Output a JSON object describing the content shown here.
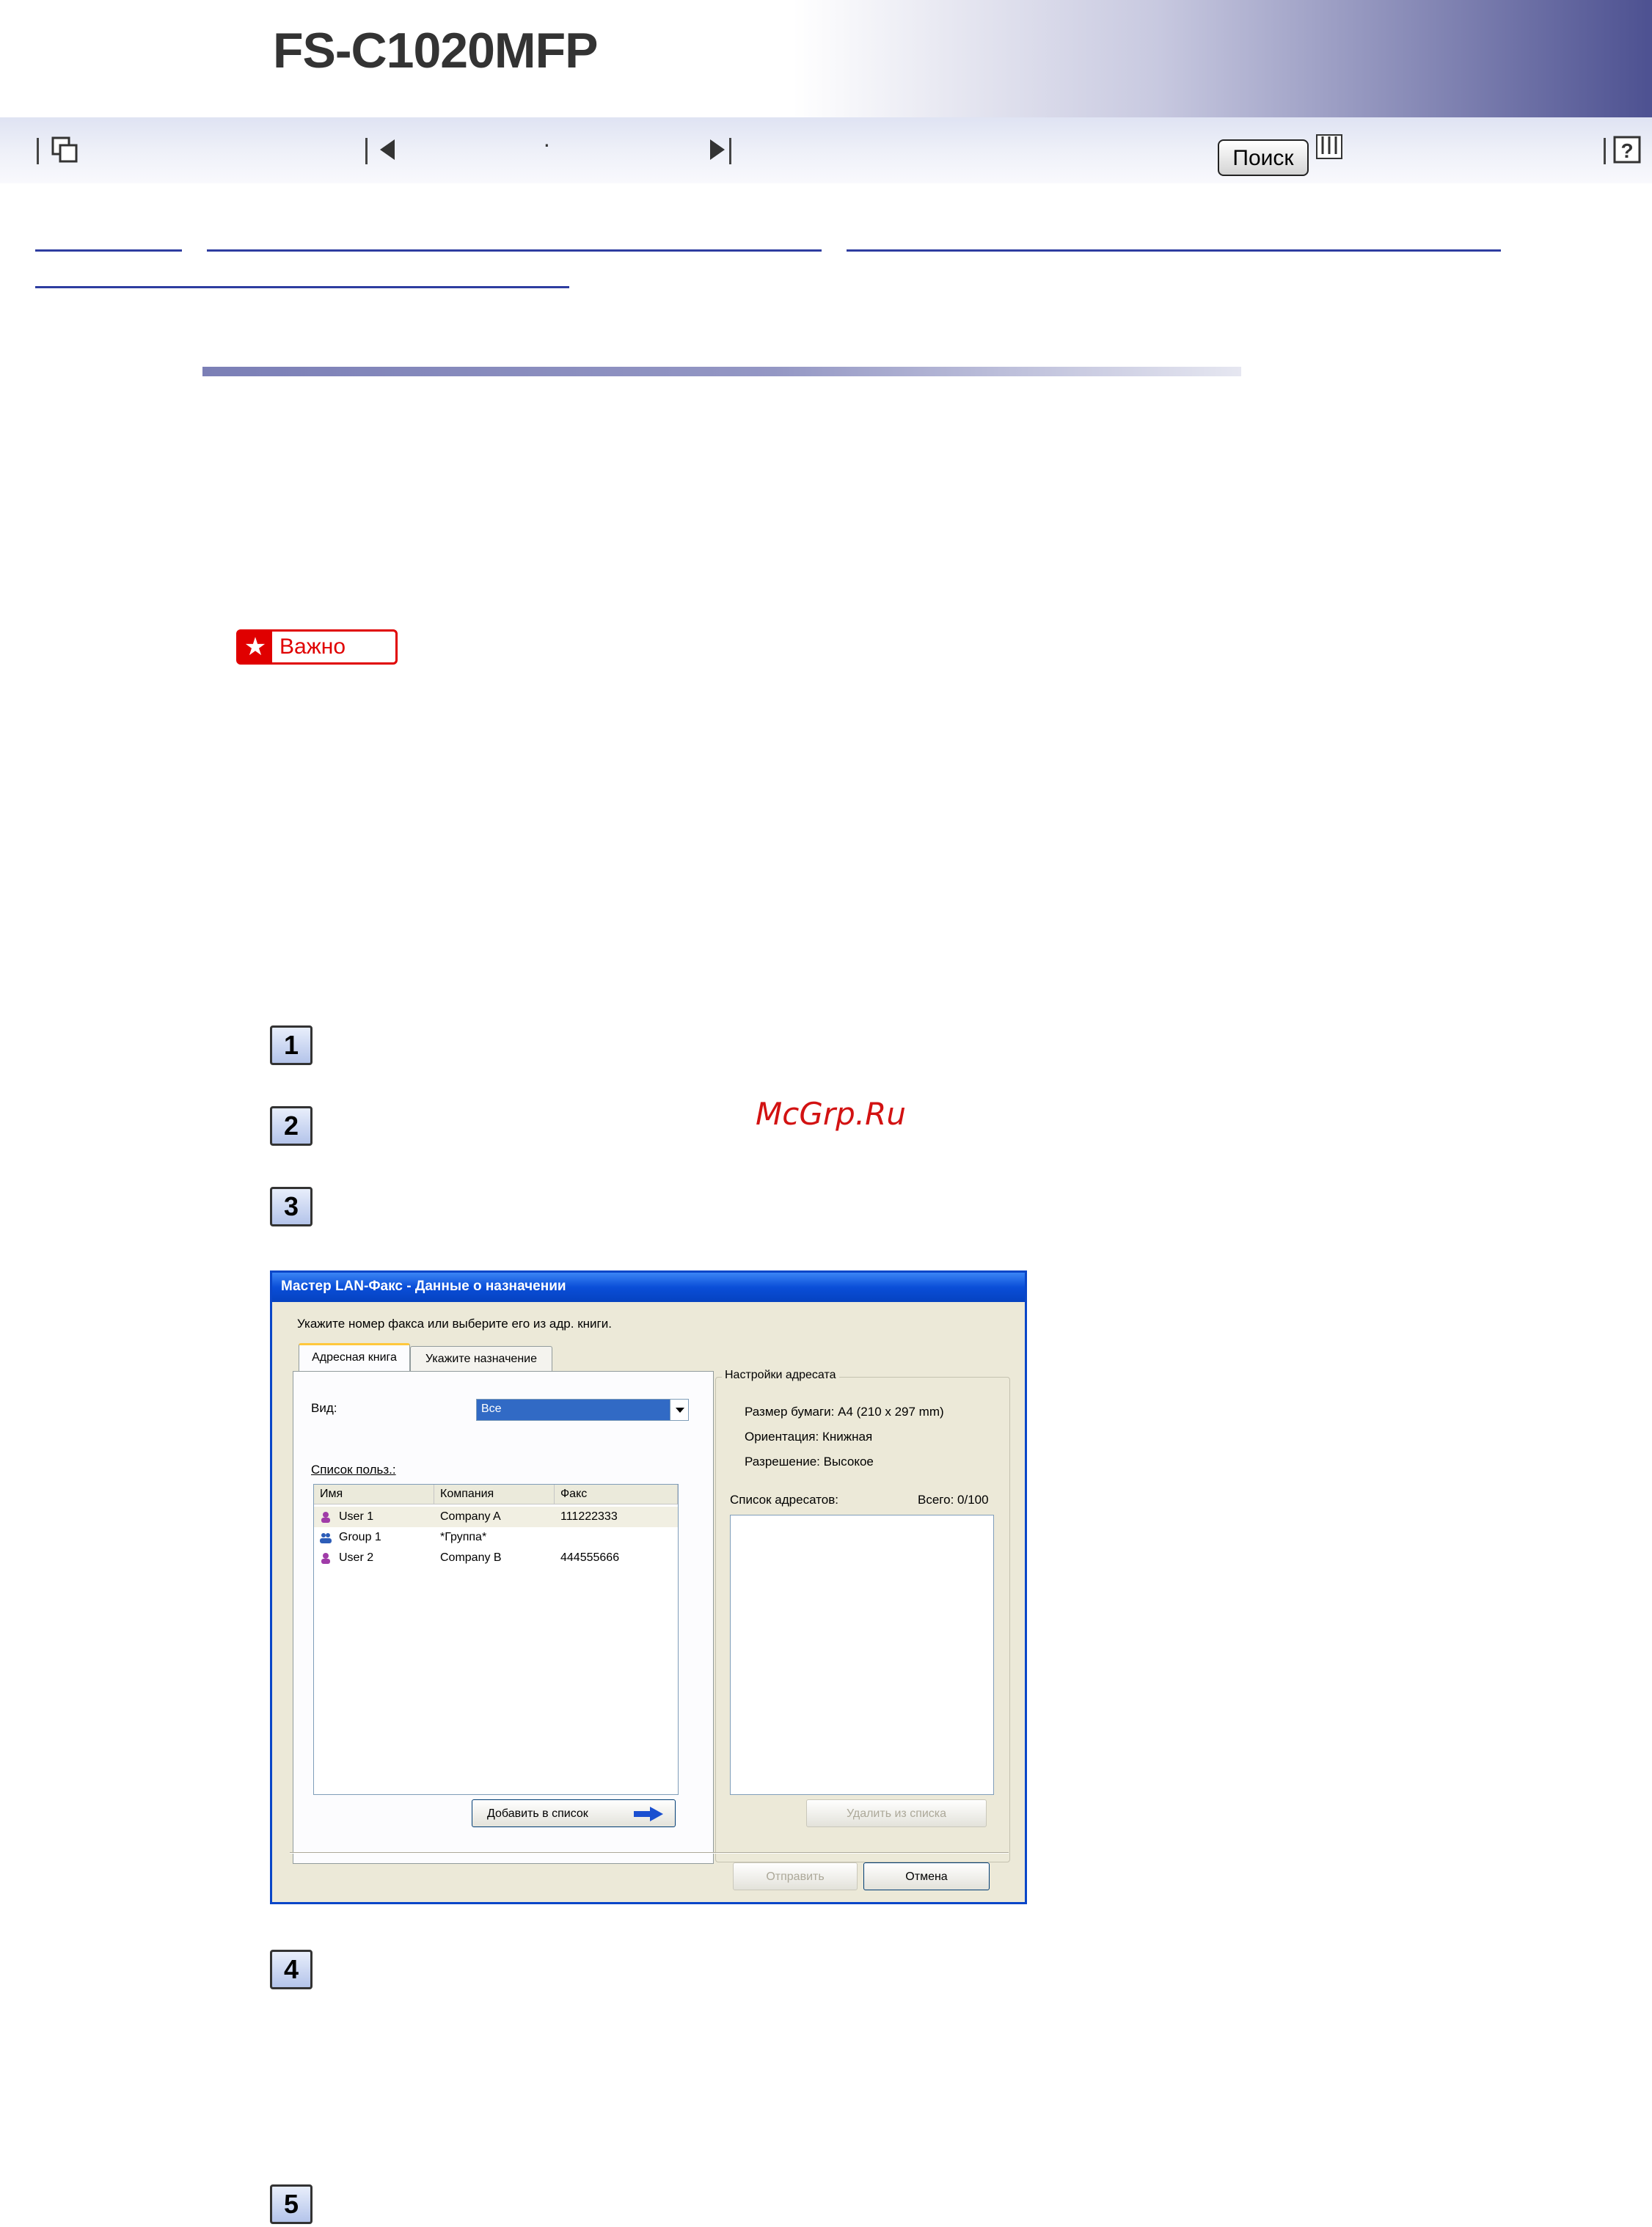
{
  "header": {
    "product": "FS-C1020MFP"
  },
  "navbar": {
    "search_label": "Поиск",
    "dot": "·"
  },
  "important": {
    "label": "Важно"
  },
  "steps": [
    "1",
    "2",
    "3",
    "4",
    "5"
  ],
  "watermark": "McGrp.Ru",
  "dialog": {
    "title": "Мастер LAN-Факс - Данные о назначении",
    "instruction": "Укажите номер факса или выберите его из адр. книги.",
    "tabs": [
      "Адресная книга",
      "Укажите назначение"
    ],
    "view_label": "Вид:",
    "view_value": "Все",
    "user_list_label": "Список польз.:",
    "columns": [
      "Имя",
      "Компания",
      "Факс"
    ],
    "rows": [
      {
        "name": "User 1",
        "company": "Company A",
        "fax": "111222333",
        "kind": "user-icon"
      },
      {
        "name": "Group 1",
        "company": "*Группа*",
        "fax": "",
        "kind": "group-icon"
      },
      {
        "name": "User 2",
        "company": "Company B",
        "fax": "444555666",
        "kind": "user-icon"
      }
    ],
    "add_button": "Добавить в список",
    "settings_title": "Настройки адресата",
    "paper_size": "Размер бумаги: A4 (210 x 297 mm)",
    "orientation": "Ориентация: Книжная",
    "resolution": "Разрешение: Высокое",
    "recipients_label": "Список адресатов:",
    "total": "Всего: 0/100",
    "remove_button": "Удалить из списка",
    "send_button": "Отправить",
    "cancel_button": "Отмена"
  }
}
